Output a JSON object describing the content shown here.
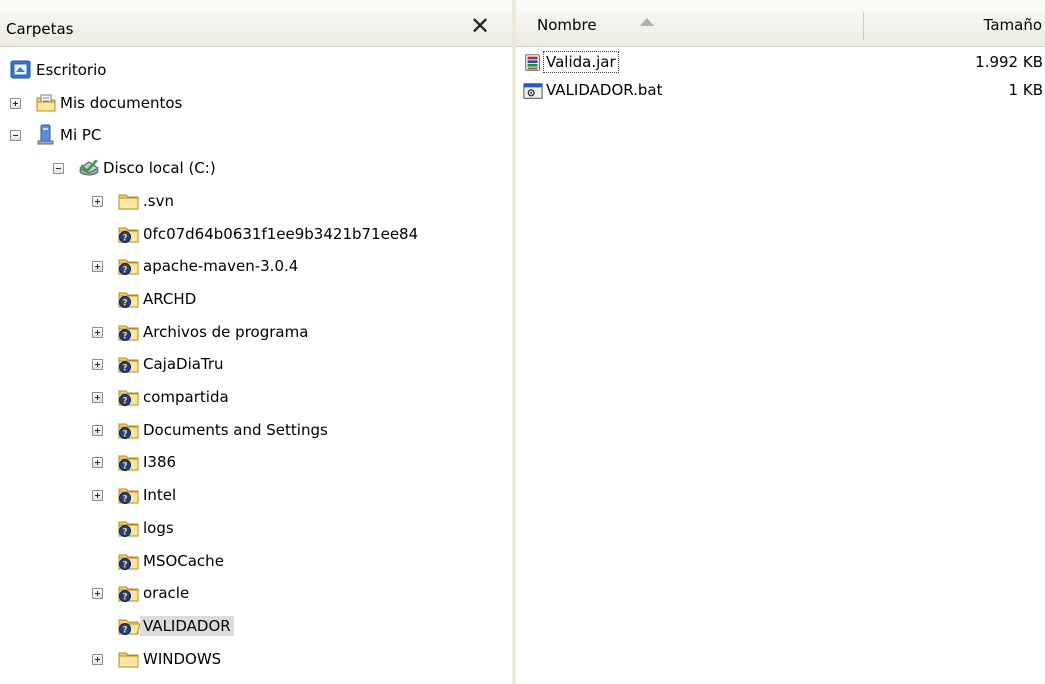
{
  "folders_pane": {
    "title": "Carpetas",
    "close_glyph": "✕",
    "tree": [
      {
        "label": "Escritorio",
        "icon": "desktop-icon",
        "expander": "none"
      },
      {
        "label": "Mis documentos",
        "icon": "my-documents-icon",
        "expander": "plus"
      },
      {
        "label": "Mi PC",
        "icon": "my-computer-icon",
        "expander": "minus"
      },
      {
        "label": "Disco local (C:)",
        "icon": "local-disk-icon",
        "expander": "minus"
      },
      {
        "label": ".svn",
        "icon": "folder-icon",
        "expander": "plus"
      },
      {
        "label": "0fc07d64b0631f1ee9b3421b71ee84",
        "icon": "shared-folder-icon",
        "expander": "none"
      },
      {
        "label": "apache-maven-3.0.4",
        "icon": "shared-folder-icon",
        "expander": "plus"
      },
      {
        "label": "ARCHD",
        "icon": "shared-folder-icon",
        "expander": "none"
      },
      {
        "label": "Archivos de programa",
        "icon": "shared-folder-icon",
        "expander": "plus"
      },
      {
        "label": "CajaDiaTru",
        "icon": "shared-folder-icon",
        "expander": "plus"
      },
      {
        "label": "compartida",
        "icon": "shared-folder-icon",
        "expander": "plus"
      },
      {
        "label": "Documents and Settings",
        "icon": "shared-folder-icon",
        "expander": "plus"
      },
      {
        "label": "I386",
        "icon": "shared-folder-icon",
        "expander": "plus"
      },
      {
        "label": "Intel",
        "icon": "shared-folder-icon",
        "expander": "plus"
      },
      {
        "label": "logs",
        "icon": "shared-folder-icon",
        "expander": "none"
      },
      {
        "label": "MSOCache",
        "icon": "shared-folder-icon",
        "expander": "none"
      },
      {
        "label": "oracle",
        "icon": "shared-folder-icon",
        "expander": "plus"
      },
      {
        "label": "VALIDADOR",
        "icon": "shared-folder-open-icon",
        "expander": "none",
        "selected": true
      },
      {
        "label": "WINDOWS",
        "icon": "folder-icon",
        "expander": "plus"
      }
    ]
  },
  "file_list": {
    "columns": {
      "name": "Nombre",
      "size": "Tamaño"
    },
    "sort": "ascending",
    "files": [
      {
        "name": "Valida.jar",
        "size": "1.992 KB",
        "icon": "jar-file-icon",
        "focused": true
      },
      {
        "name": "VALIDADOR.bat",
        "size": "1 KB",
        "icon": "batch-file-icon",
        "focused": false
      }
    ]
  },
  "colors": {
    "header_bg": "#ecebe3",
    "selection_bg": "#dcdcdc",
    "divider": "#ece9d8"
  }
}
